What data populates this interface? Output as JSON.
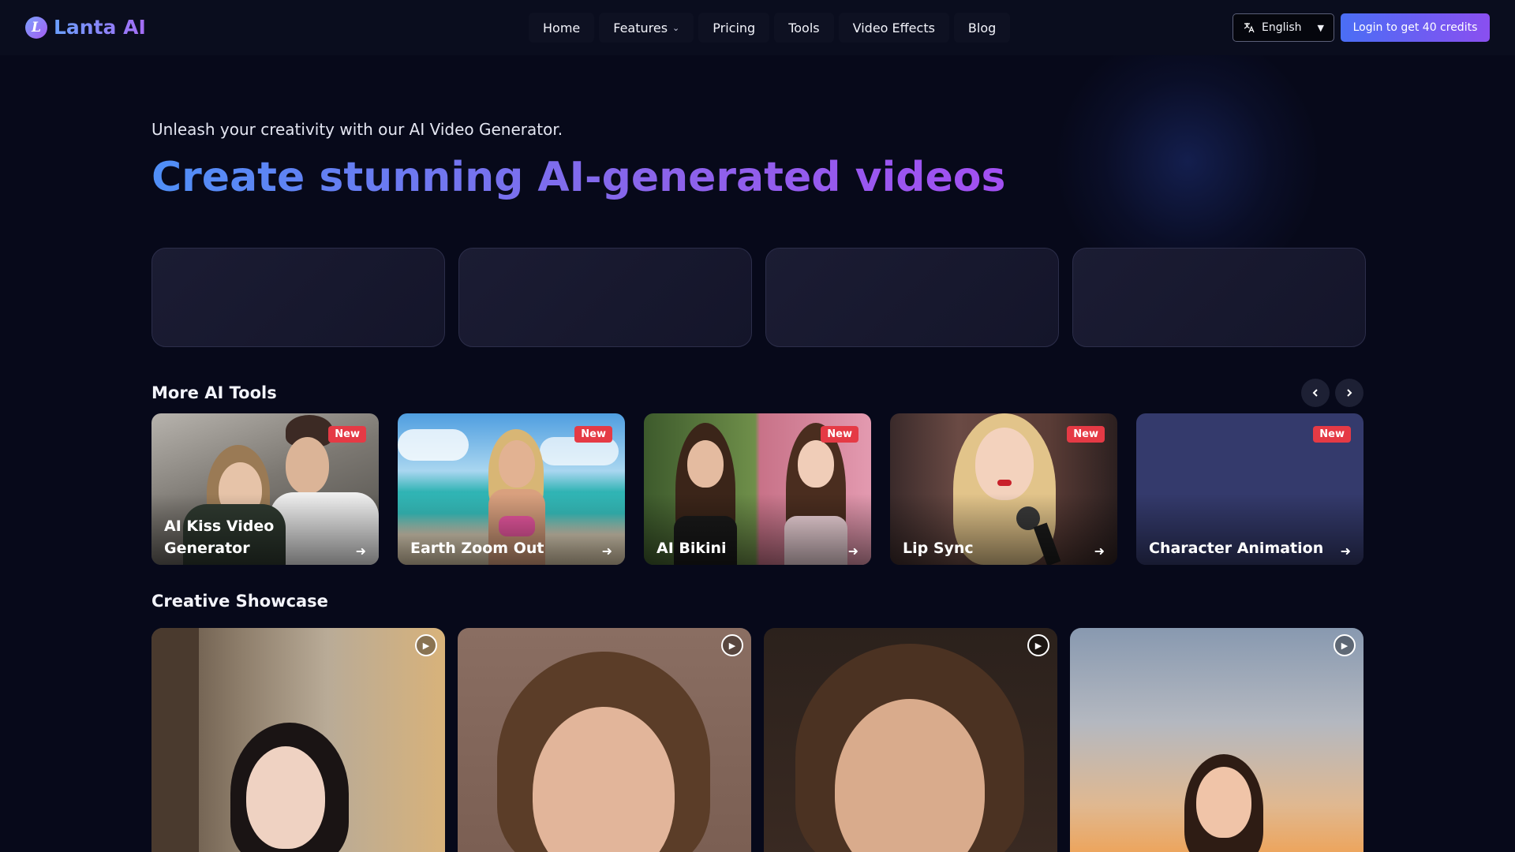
{
  "brand": {
    "logo_letter": "L",
    "name": "Lanta AI"
  },
  "nav": {
    "items": [
      {
        "label": "Home"
      },
      {
        "label": "Features",
        "has_dropdown": true
      },
      {
        "label": "Pricing"
      },
      {
        "label": "Tools"
      },
      {
        "label": "Video Effects"
      },
      {
        "label": "Blog"
      }
    ]
  },
  "language": {
    "selected": "English",
    "icon": "translate-icon"
  },
  "login": {
    "label": "Login to get 40 credits"
  },
  "hero": {
    "subtitle": "Unleash your creativity with our AI Video Generator.",
    "title": "Create stunning AI-generated videos"
  },
  "tools": {
    "title": "More AI Tools",
    "prev_icon": "chevron-left-icon",
    "next_icon": "chevron-right-icon",
    "items": [
      {
        "label": "AI Kiss Video Generator",
        "badge": "New"
      },
      {
        "label": "Earth Zoom Out",
        "badge": "New"
      },
      {
        "label": "AI Bikini",
        "badge": "New"
      },
      {
        "label": "Lip Sync",
        "badge": "New"
      },
      {
        "label": "Character Animation",
        "badge": "New"
      }
    ]
  },
  "showcase": {
    "title": "Creative Showcase",
    "items": [
      {
        "play_icon": "play-icon"
      },
      {
        "play_icon": "play-icon"
      },
      {
        "play_icon": "play-icon"
      },
      {
        "play_icon": "play-icon"
      }
    ]
  },
  "colors": {
    "background": "#07091a",
    "accent_start": "#4a6ef5",
    "accent_end": "#8a4ff0",
    "badge": "#e53a45"
  }
}
